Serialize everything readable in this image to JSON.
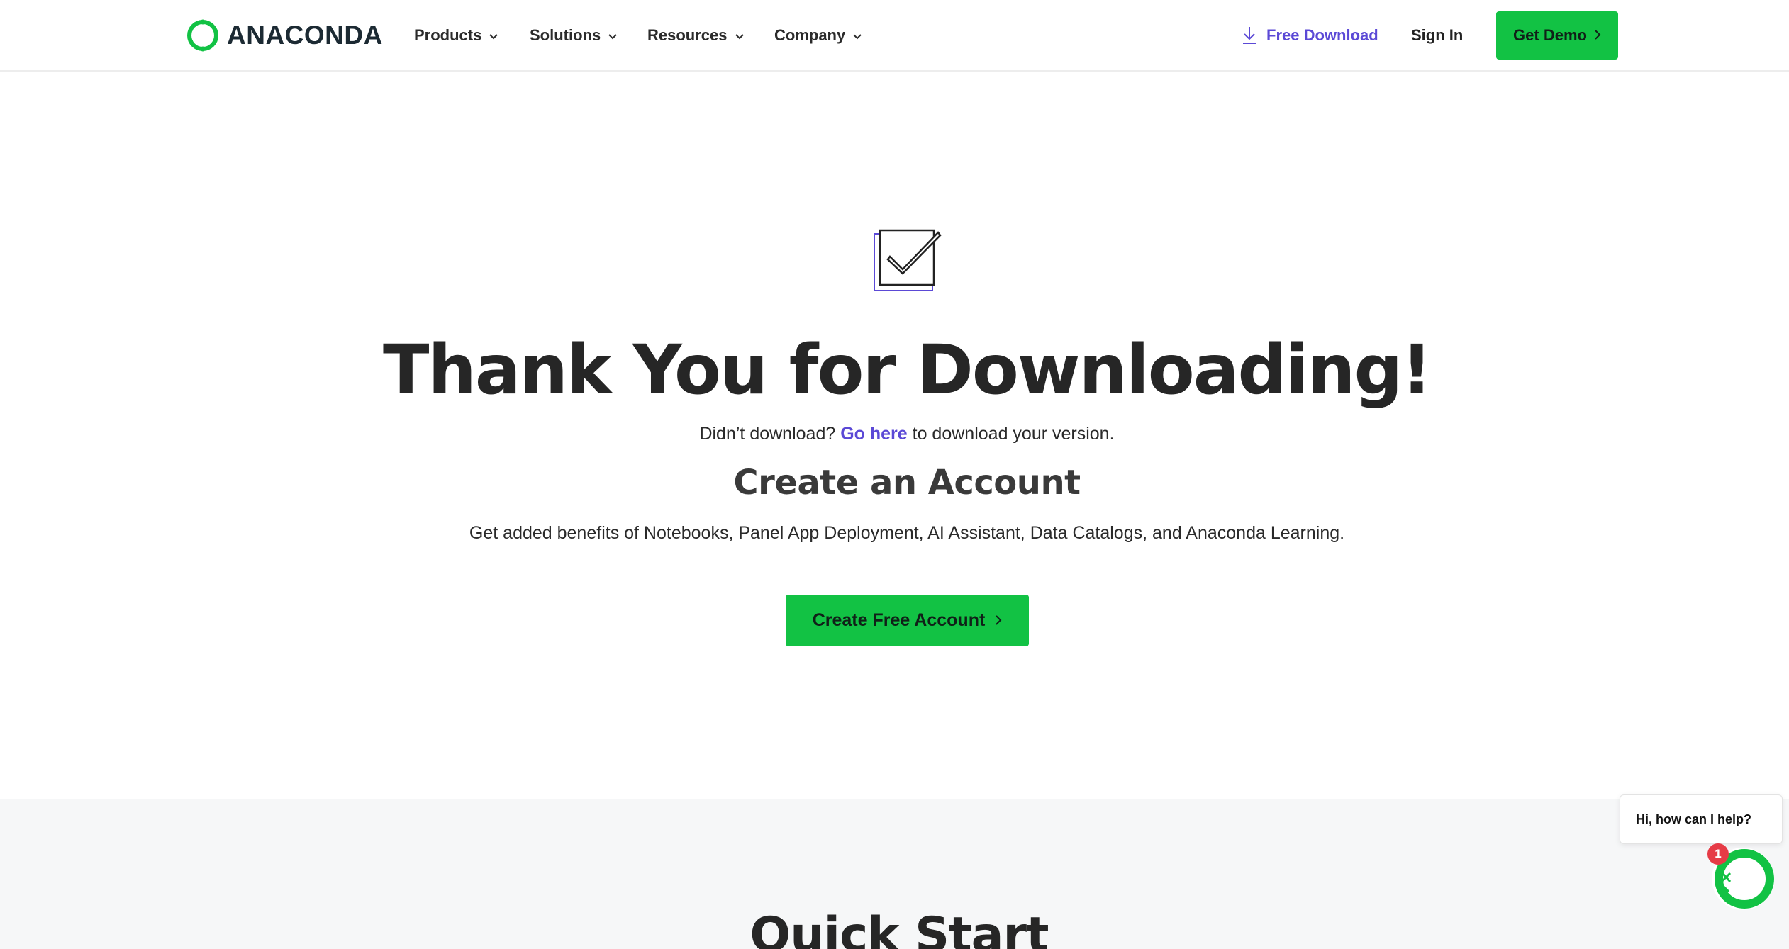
{
  "header": {
    "logo_text": "ANACONDA",
    "nav": [
      {
        "label": "Products"
      },
      {
        "label": "Solutions"
      },
      {
        "label": "Resources"
      },
      {
        "label": "Company"
      }
    ],
    "free_download_label": "Free Download",
    "sign_in_label": "Sign In",
    "get_demo_label": "Get Demo"
  },
  "hero": {
    "title": "Thank You for Downloading!",
    "didnt_prefix": "Didn’t download?",
    "go_here_link": "Go here",
    "didnt_suffix": "to download your version.",
    "account_title": "Create an Account",
    "benefits": "Get added benefits of Notebooks, Panel App Deployment, AI Assistant, Data Catalogs, and Anaconda Learning.",
    "create_button_label": "Create Free Account"
  },
  "quick_start": {
    "title": "Quick Start"
  },
  "chat": {
    "bubble_text": "Hi, how can I help?",
    "badge_count": "1"
  },
  "colors": {
    "brand_green": "#12c244",
    "link_purple": "#5b49d6",
    "badge_red": "#e63b46"
  },
  "icons": {
    "logo": "anaconda-ring-logo",
    "download": "download-arrow-icon",
    "nav_chevron": "chevron-down-icon",
    "button_arrow": "chevron-right-icon",
    "hero": "checkbox-icon",
    "chat": "anaconda-chat-icon"
  }
}
